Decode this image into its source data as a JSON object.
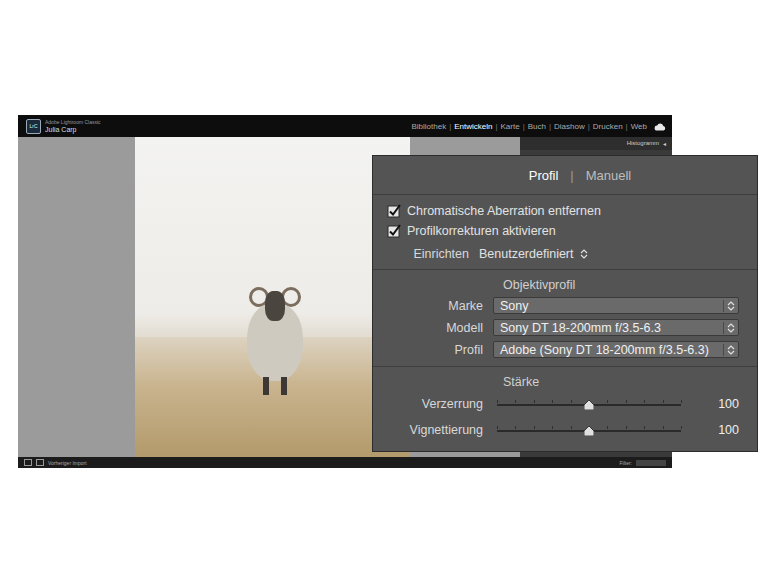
{
  "window": {
    "app_logo": "LrC",
    "app_name": "Adobe Lightroom Classic",
    "user": "Julia Carp"
  },
  "modules": [
    {
      "label": "Bibliothek",
      "selected": false
    },
    {
      "label": "Entwickeln",
      "selected": true
    },
    {
      "label": "Karte",
      "selected": false
    },
    {
      "label": "Buch",
      "selected": false
    },
    {
      "label": "Diashow",
      "selected": false
    },
    {
      "label": "Drucken",
      "selected": false
    },
    {
      "label": "Web",
      "selected": false
    }
  ],
  "module_separator": "|",
  "right_panel": {
    "title": "Histogramm",
    "toggle": "◂"
  },
  "filmstrip": {
    "source": "Vorheriger Import",
    "filter_label": "Filter:"
  },
  "lens_panel": {
    "tabs": [
      {
        "label": "Profil",
        "selected": true
      },
      {
        "label": "Manuell",
        "selected": false
      }
    ],
    "tab_separator": "|",
    "options": [
      {
        "label": "Chromatische Aberration entfernen",
        "checked": true
      },
      {
        "label": "Profilkorrekturen aktivieren",
        "checked": true
      }
    ],
    "setup": {
      "label": "Einrichten",
      "value": "Benutzerdefiniert"
    },
    "profile_section": "Objektivprofil",
    "fields": [
      {
        "label": "Marke",
        "value": "Sony"
      },
      {
        "label": "Modell",
        "value": "Sony DT 18-200mm f/3.5-6.3"
      },
      {
        "label": "Profil",
        "value": "Adobe (Sony DT 18-200mm f/3.5-6.3)"
      }
    ],
    "amount_section": "Stärke",
    "sliders": [
      {
        "label": "Verzerrung",
        "level": 0.5,
        "reading": "100"
      },
      {
        "label": "Vignettierung",
        "level": 0.5,
        "reading": "100"
      }
    ]
  }
}
